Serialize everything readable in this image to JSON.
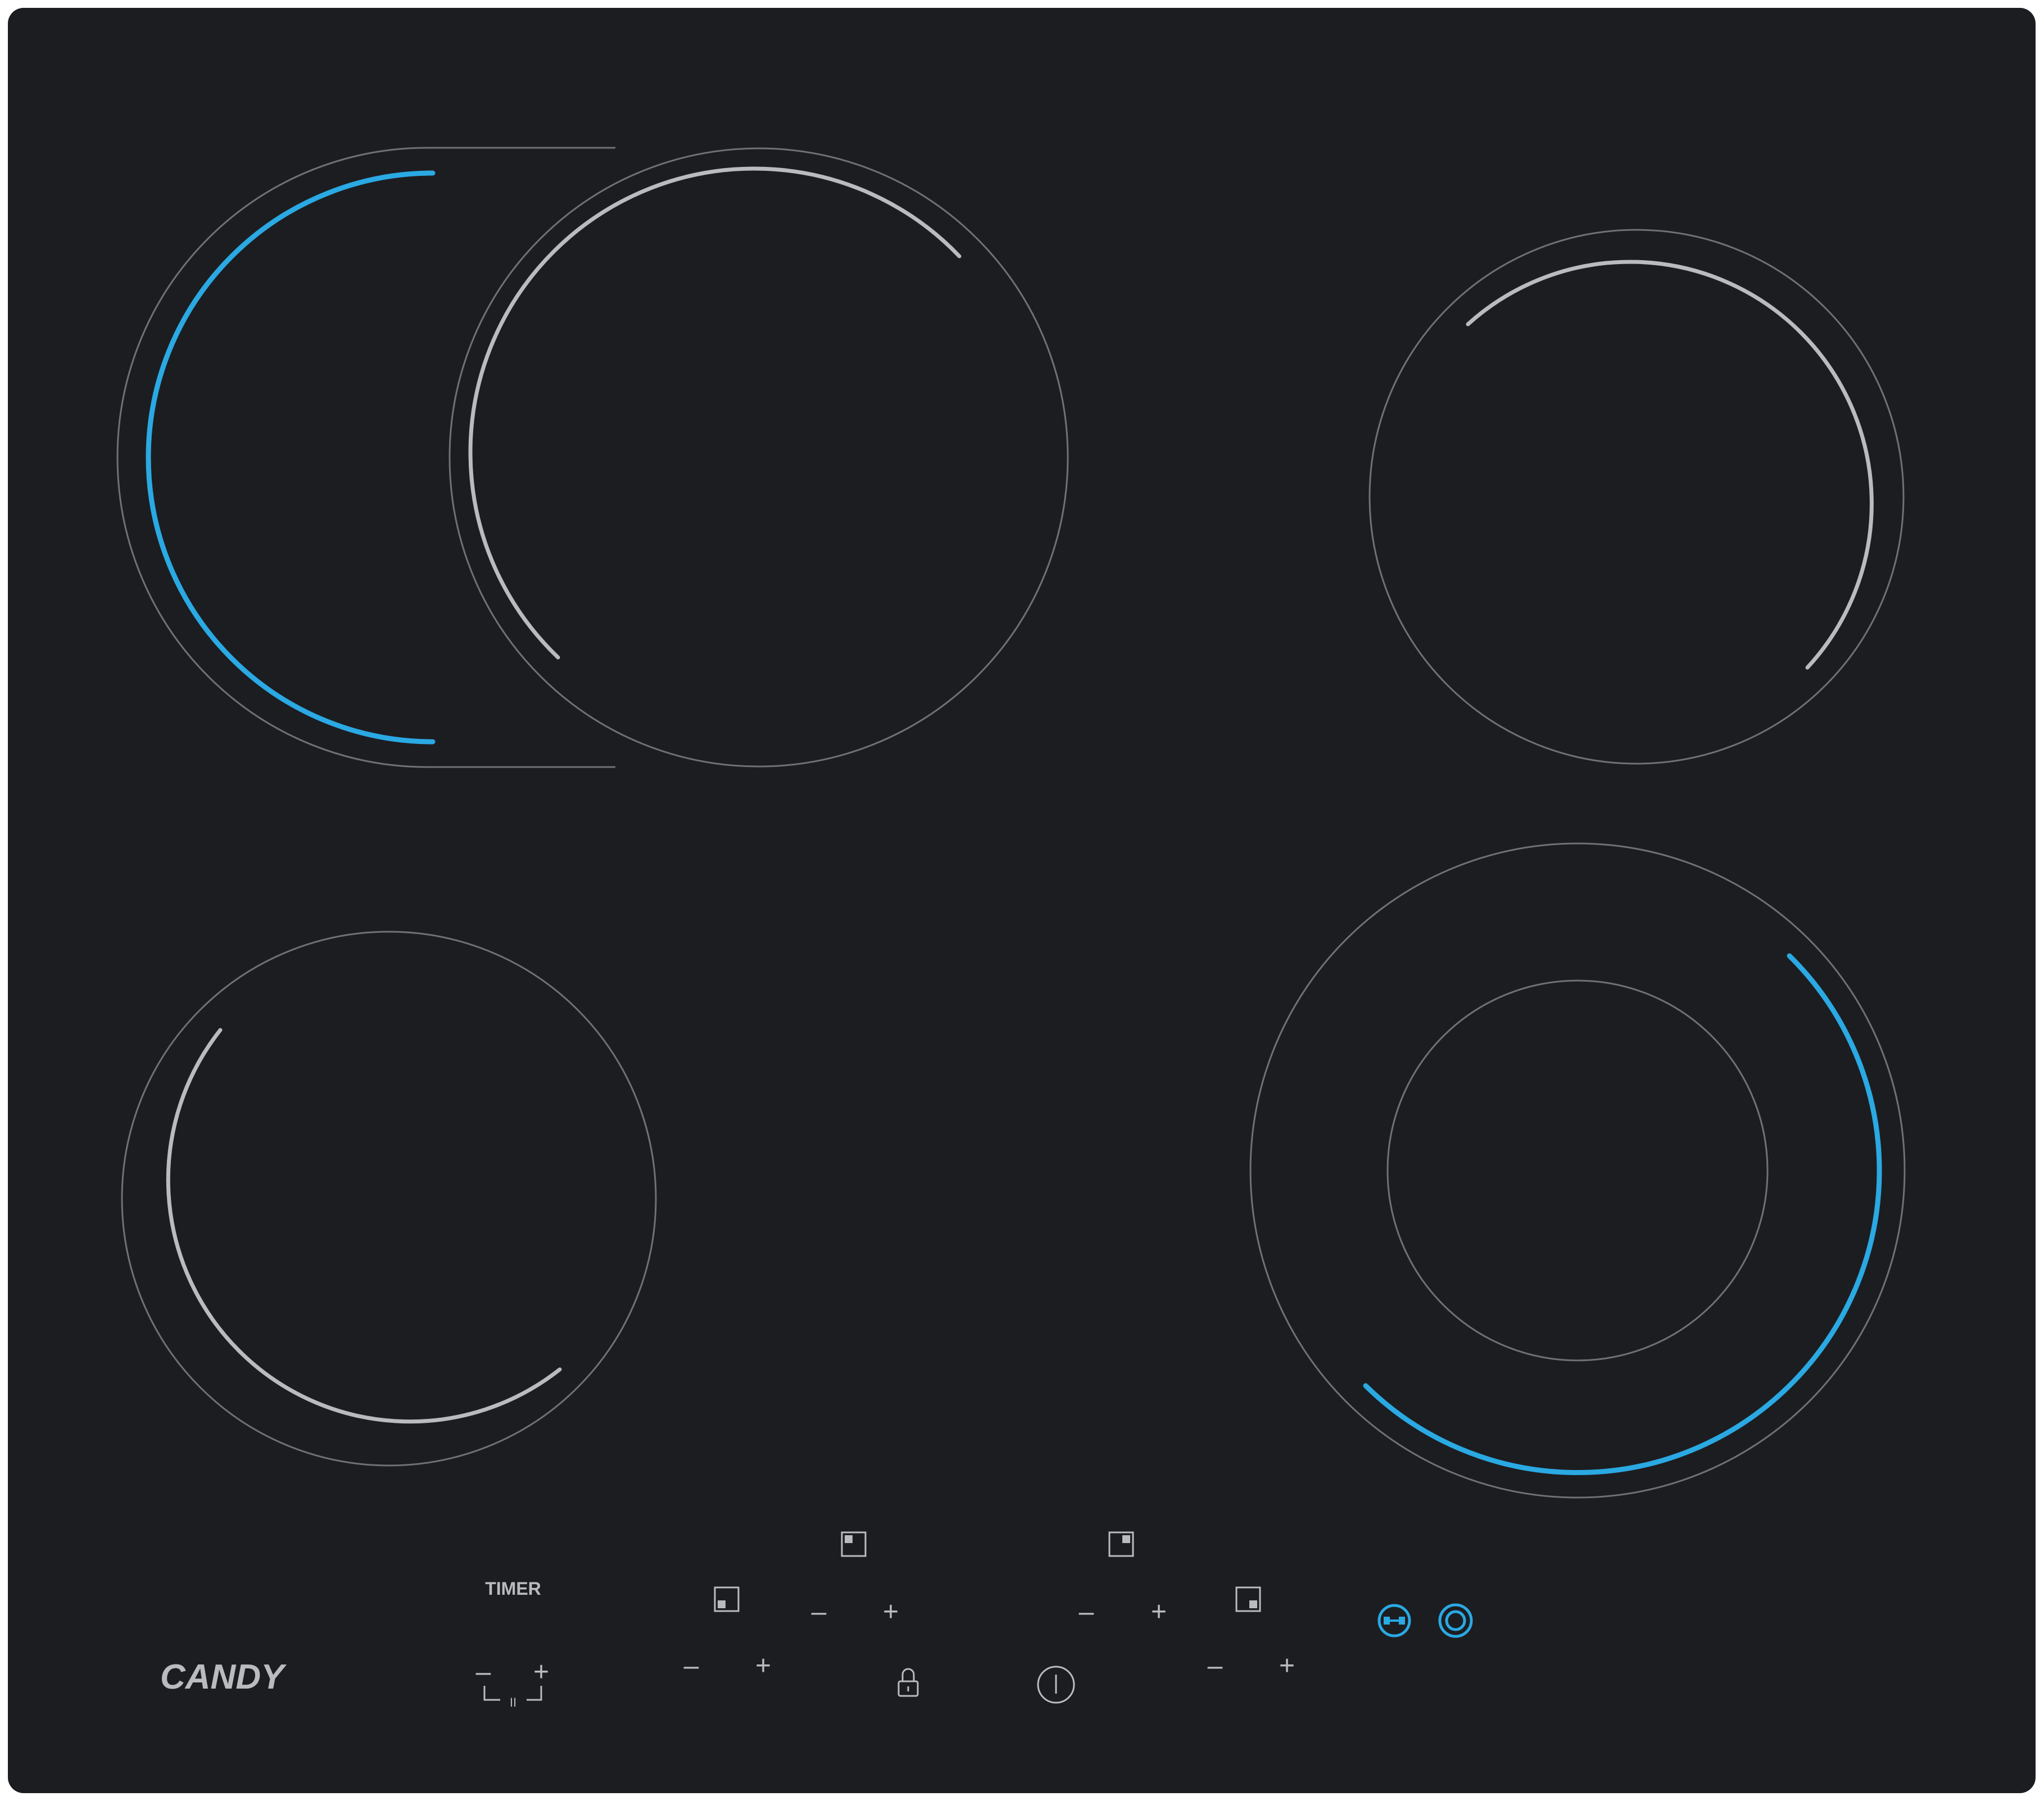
{
  "brand": {
    "logo_text": "CANDY"
  },
  "timer": {
    "label": "TIMER",
    "pause_symbol": "II"
  },
  "colors": {
    "glass": "#1c1d21",
    "ring": "#6f7177",
    "arc_white": "#b9bbbe",
    "arc_blue": "#2aa9e3",
    "text": "#b9bbbe"
  },
  "zones": [
    {
      "name": "rear-left-dual-zone",
      "indicator": "blue"
    },
    {
      "name": "rear-center-zone",
      "indicator": "white"
    },
    {
      "name": "rear-right-zone",
      "indicator": "white"
    },
    {
      "name": "front-left-zone",
      "indicator": "white"
    },
    {
      "name": "front-right-dual-zone",
      "indicator": "blue"
    }
  ],
  "controls": {
    "minus": "–",
    "plus": "+",
    "icons": [
      "zone-selector-icon",
      "lock-icon",
      "power-icon",
      "dual-zone-icon",
      "extended-zone-icon"
    ]
  }
}
